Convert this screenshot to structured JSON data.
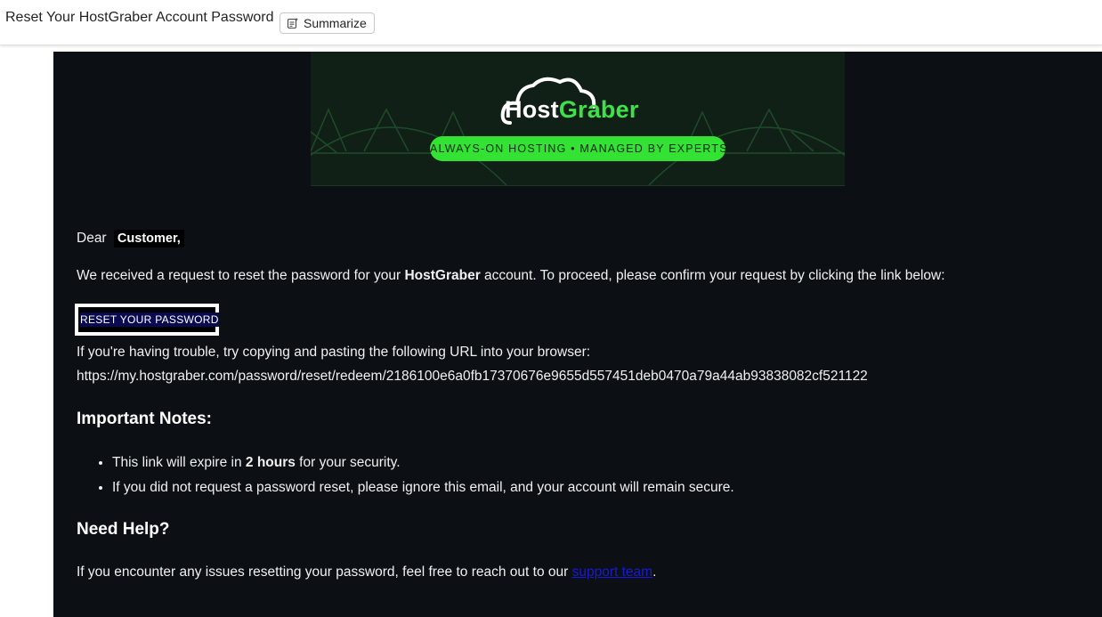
{
  "header": {
    "subject": "Reset Your HostGraber Account Password",
    "summarize_label": "Summarize"
  },
  "banner": {
    "logo_host": "Host",
    "logo_graber": "Graber",
    "tagline": "ALWAYS-ON HOSTING • MANAGED BY EXPERTS"
  },
  "email": {
    "greeting": "Dear",
    "customer_name": "Customer,",
    "intro_before": "We received a request to reset the password for your ",
    "intro_brand": "HostGraber",
    "intro_after": " account. To proceed, please confirm your request by clicking the link below:",
    "reset_button_label": "RESET  YOUR PASSWORD",
    "trouble_text": "If you're having trouble, try copying and pasting the following URL into your browser:",
    "reset_url": "https://my.hostgraber.com/password/reset/redeem/2186100e6a0fb17370676e9655d557451deb0470a79a44ab93838082cf521122",
    "notes_heading": "Important Notes:",
    "note1_before": "This link will expire in ",
    "note1_bold": "2 hours",
    "note1_after": " for your security.",
    "note2": "If you did not request a password reset, please ignore this email, and your account will remain secure.",
    "help_heading": "Need Help?",
    "help_before": "If you encounter any issues resetting your password, feel free to reach out to our ",
    "help_link": "support team",
    "help_after": "."
  },
  "colors": {
    "email_background": "#0c1014",
    "accent_green": "#33e233",
    "link_blue": "#1a1ad6"
  }
}
